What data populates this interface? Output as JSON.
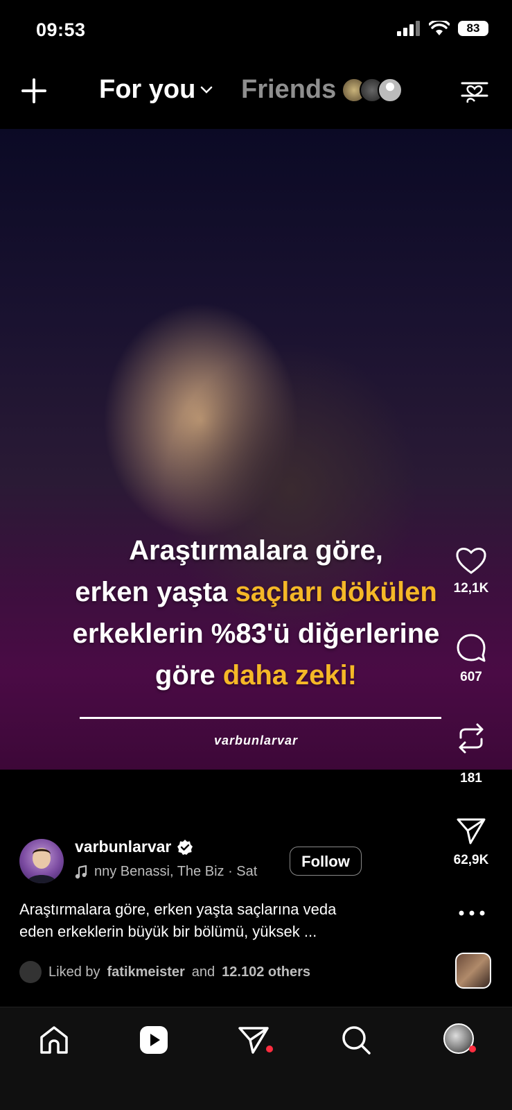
{
  "status_bar": {
    "time": "09:53",
    "battery": "83"
  },
  "header": {
    "tab_for_you": "For you",
    "tab_friends": "Friends"
  },
  "post": {
    "overlay_lines": [
      [
        "Araştırmalara göre,"
      ],
      [
        "erken yaşta ",
        "saçları dökülen"
      ],
      [
        "erkeklerin %83'ü diğerlerine"
      ],
      [
        "göre ",
        "daha zeki!"
      ]
    ],
    "overlay_brand": "varbunlarvar",
    "likes": "12,1K",
    "comments": "607",
    "reposts": "181",
    "shares": "62,9K",
    "author": "varbunlarvar",
    "music": "nny Benassi, The Biz · Sat",
    "follow_label": "Follow",
    "description_line1": "Araştırmalara göre, erken yaşta saçlarına veda",
    "description_line2": "eden erkeklerin büyük bir bölümü, yüksek ...",
    "liked_prefix": "Liked by",
    "liked_user": "fatikmeister",
    "liked_and": "and",
    "liked_others": "12.102 others"
  },
  "colors": {
    "highlight": "#f5b827",
    "notification": "#ff2d3f",
    "background": "#000000"
  },
  "icons": [
    "plus-icon",
    "chevron-down-icon",
    "filter-heart-icon",
    "heart-icon",
    "comment-icon",
    "repost-icon",
    "send-icon",
    "more-icon",
    "music-note-icon",
    "verified-icon",
    "home-icon",
    "reels-icon",
    "messages-icon",
    "search-icon",
    "profile-icon"
  ]
}
